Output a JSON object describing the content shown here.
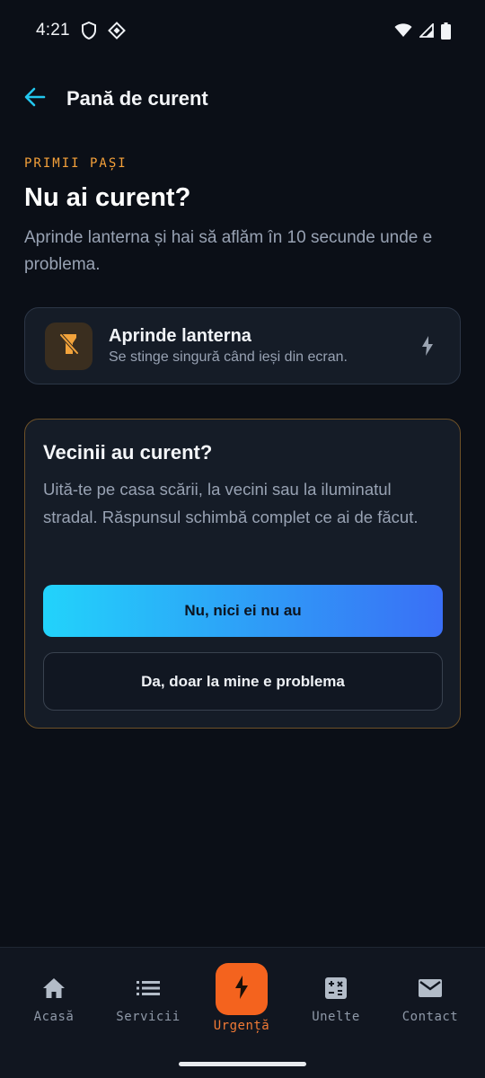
{
  "status_bar": {
    "time": "4:21",
    "icons": [
      "shield-icon",
      "vpn-key-icon",
      "wifi-icon",
      "cellular-signal-icon",
      "battery-icon"
    ]
  },
  "app_bar": {
    "back_icon": "arrow-left-icon",
    "title": "Pană de curent"
  },
  "intro": {
    "eyebrow": "PRIMII PAȘI",
    "headline": "Nu ai curent?",
    "subtitle": "Aprinde lanterna și hai să aflăm în 10 secunde unde e problema."
  },
  "flashlight_card": {
    "icon": "flashlight-off-icon",
    "title": "Aprinde lanterna",
    "subtitle": "Se stinge singură când ieși din ecran.",
    "trailing_icon": "bolt-icon"
  },
  "question_card": {
    "title": "Vecinii au curent?",
    "body": "Uită-te pe casa scării, la vecini sau la iluminatul stradal. Răspunsul schimbă complet ce ai de făcut.",
    "primary_button": "Nu, nici ei nu au",
    "secondary_button": "Da, doar la mine e problema"
  },
  "bottom_nav": {
    "items": [
      {
        "label": "Acasă",
        "icon": "home-icon"
      },
      {
        "label": "Servicii",
        "icon": "list-icon"
      },
      {
        "label": "Urgență",
        "icon": "bolt-icon",
        "active": true
      },
      {
        "label": "Unelte",
        "icon": "calculator-icon"
      },
      {
        "label": "Contact",
        "icon": "mail-icon"
      }
    ]
  },
  "colors": {
    "background": "#0b0f17",
    "accent_orange": "#f4631e",
    "eyebrow_orange": "#f5a13a",
    "accent_cyan": "#22d3fb",
    "gradient_blue": "#3a6ff6"
  }
}
